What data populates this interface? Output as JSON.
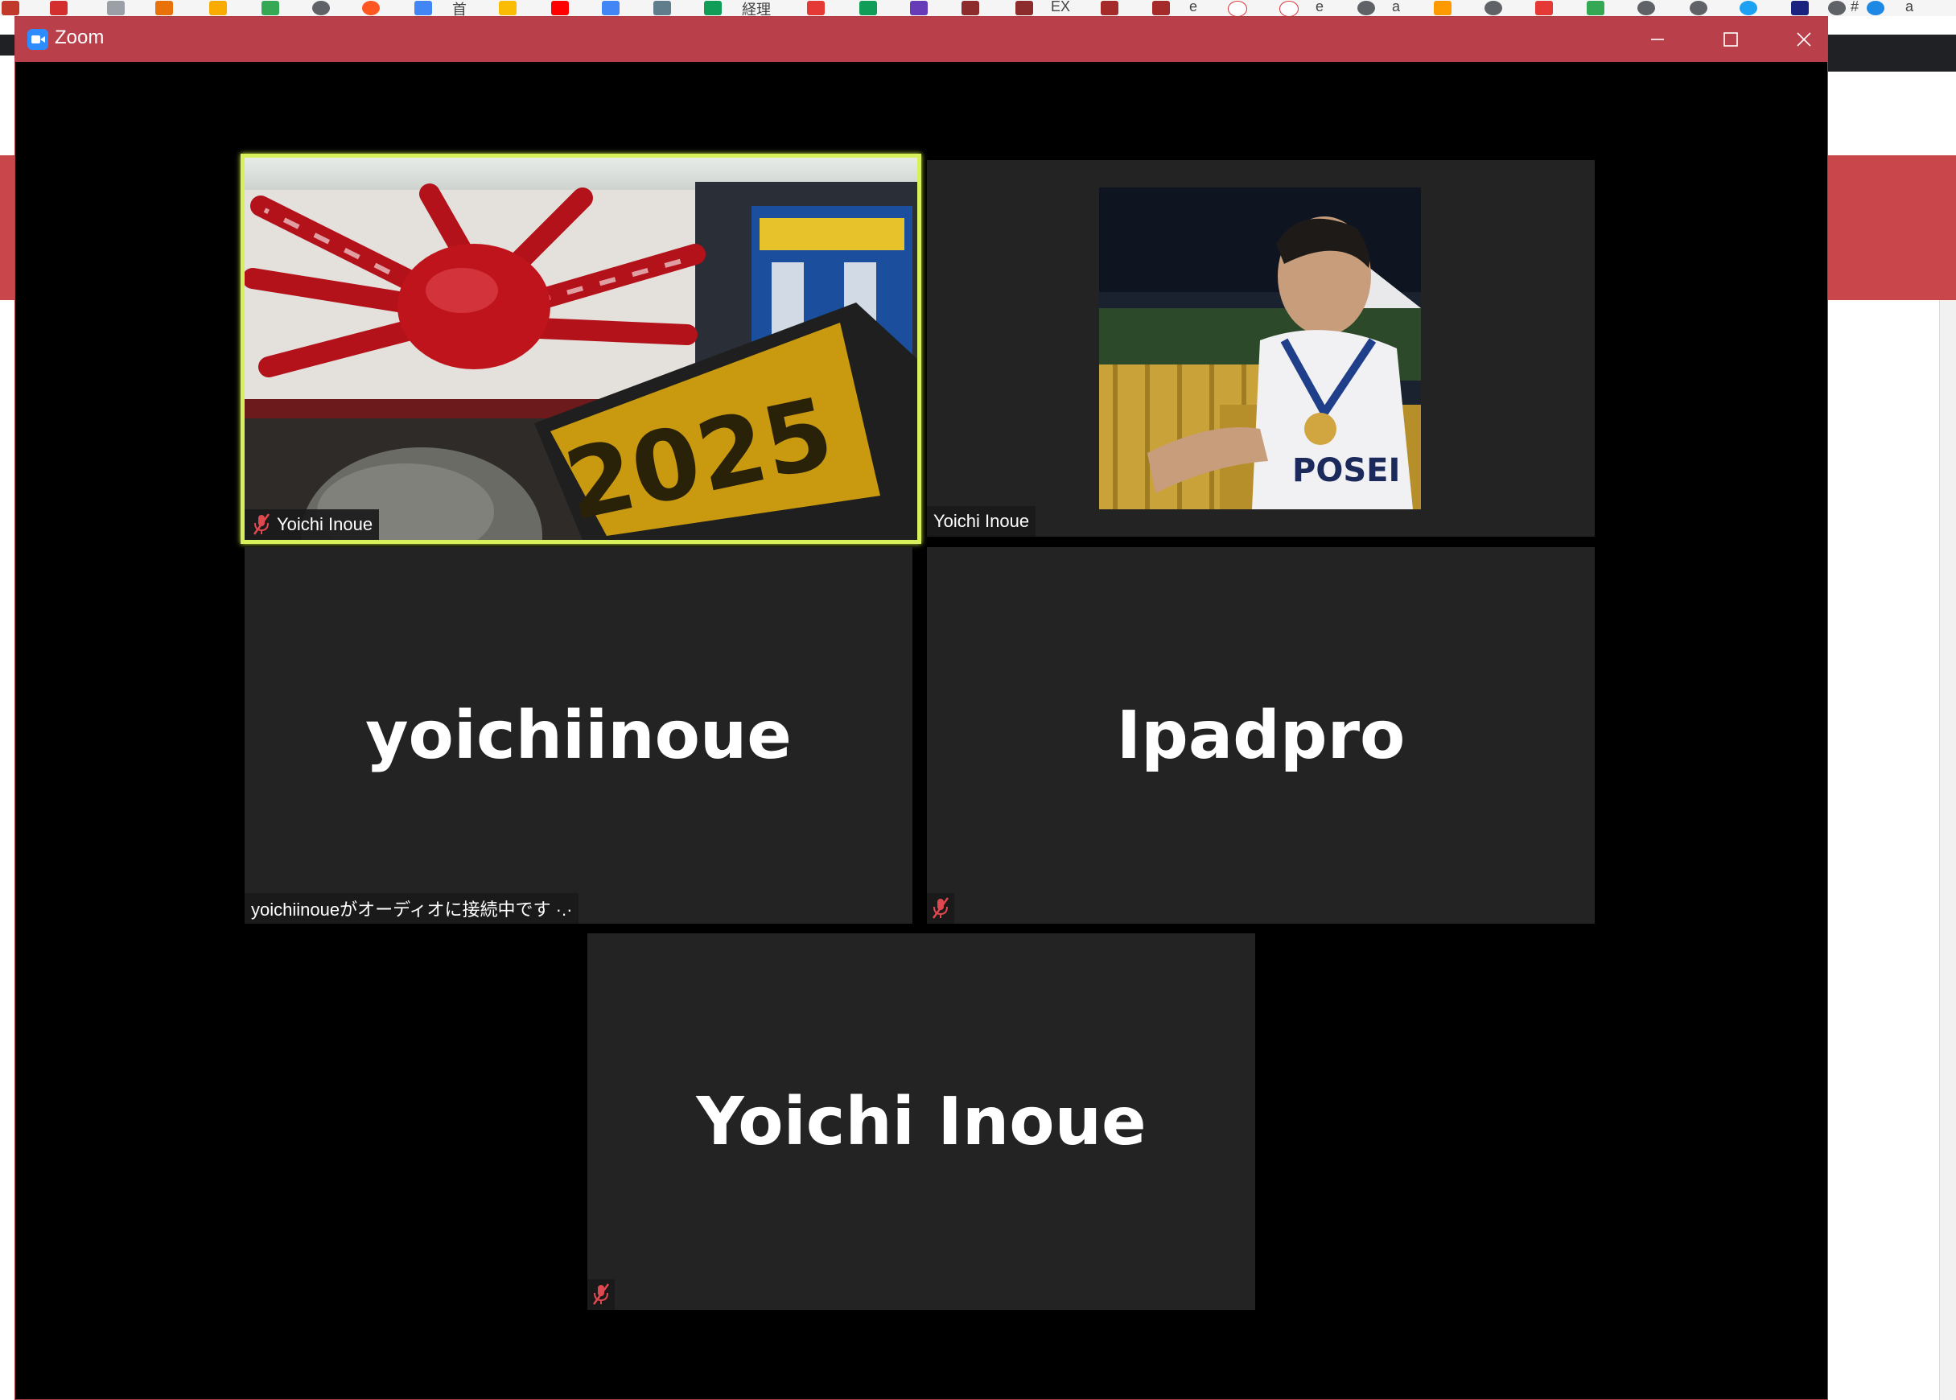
{
  "window": {
    "title": "Zoom",
    "controls": {
      "minimize": "─",
      "maximize": "☐",
      "close": "✕"
    }
  },
  "bookmarks_bar": {
    "labels": [
      "首",
      "経理",
      "EX",
      "e",
      "e",
      "a",
      "#",
      "a"
    ]
  },
  "participants": [
    {
      "name": "Yoichi Inoue",
      "video": "on",
      "muted": true,
      "active_speaker": true,
      "label": "Yoichi Inoue"
    },
    {
      "name": "Yoichi Inoue",
      "video": "profile_photo",
      "muted": false,
      "label": "Yoichi Inoue"
    },
    {
      "name": "yoichiinoue",
      "video": "off",
      "display_name": "yoichiinoue",
      "status": "yoichiinoueがオーディオに接続中です ·.·"
    },
    {
      "name": "Ipadpro",
      "video": "off",
      "display_name": "Ipadpro",
      "muted": true
    },
    {
      "name": "Yoichi Inoue",
      "video": "off",
      "display_name": "Yoichi Inoue",
      "muted": true
    }
  ],
  "colors": {
    "titlebar": "#b9404a",
    "tile_background": "#232323",
    "active_speaker_border": "#d7f05c",
    "mute_icon": "#e0484f"
  },
  "icons": [
    "zoom-app-icon",
    "microphone-muted-icon"
  ]
}
